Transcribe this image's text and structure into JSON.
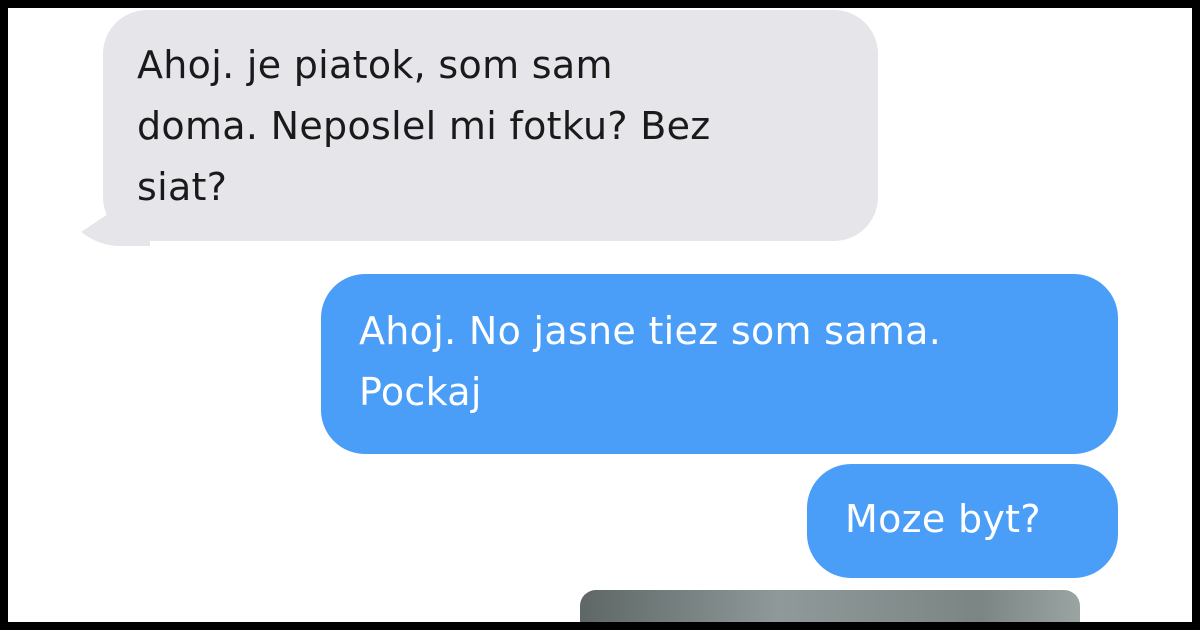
{
  "messages": [
    {
      "direction": "incoming",
      "lines": [
        "Ahoj. je piatok, som sam",
        "doma. Neposlel mi fotku? Bez",
        "siat?"
      ]
    },
    {
      "direction": "outgoing",
      "lines": [
        "Ahoj. No jasne tiez som sama.",
        "Pockaj"
      ]
    },
    {
      "direction": "outgoing",
      "lines": [
        "Moze byt?"
      ]
    }
  ],
  "colors": {
    "incoming_bubble": "#e6e5ea",
    "outgoing_bubble": "#4a9ef8",
    "frame": "#000000",
    "photo_preview": "#7b8584"
  },
  "attachment": {
    "type": "photo",
    "partially_visible": true
  }
}
